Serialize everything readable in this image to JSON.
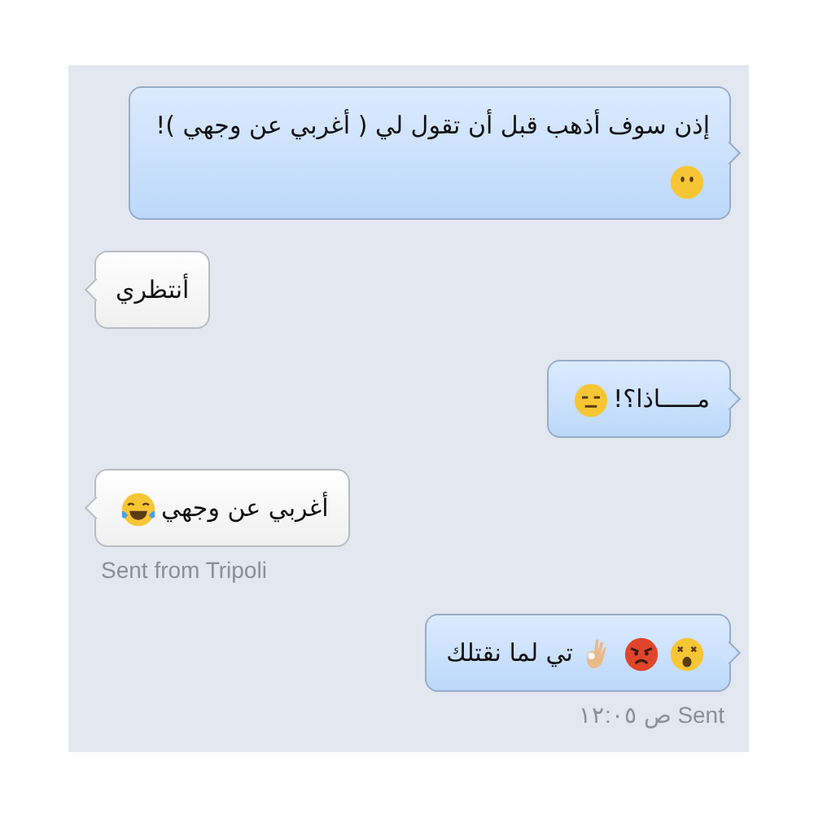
{
  "messages": [
    {
      "kind": "sent",
      "parts": [
        {
          "kind": "text",
          "text": "إذن سوف أذهب قبل أن تقول لي ( أغربي عن وجهي )!"
        },
        {
          "kind": "blank"
        }
      ]
    },
    {
      "kind": "received",
      "parts": [
        {
          "kind": "text",
          "text": "أنتظري"
        }
      ]
    },
    {
      "kind": "sent",
      "parts": [
        {
          "kind": "text",
          "text": "مـــــاذا؟!"
        },
        {
          "kind": "expressionless"
        }
      ]
    },
    {
      "kind": "received",
      "parts": [
        {
          "kind": "text",
          "text": "أغربي عن وجهي"
        },
        {
          "kind": "tears"
        }
      ],
      "note": "Sent from Tripoli"
    },
    {
      "kind": "sent",
      "parts": [
        {
          "kind": "dizzy"
        },
        {
          "kind": "angry"
        },
        {
          "kind": "ok"
        },
        {
          "kind": "text",
          "text": "تي لما نقتلك"
        }
      ],
      "note": "Sent ص ١٢:٠٥"
    }
  ]
}
